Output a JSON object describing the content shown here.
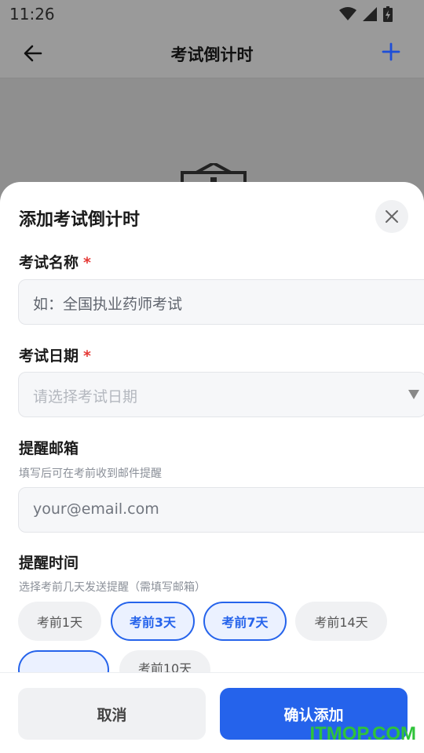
{
  "status_bar": {
    "time": "11:26"
  },
  "header": {
    "title": "考试倒计时"
  },
  "sheet": {
    "title": "添加考试倒计时",
    "exam_name": {
      "label": "考试名称",
      "required_mark": "*",
      "placeholder": "如：全国执业药师考试"
    },
    "exam_date": {
      "label": "考试日期",
      "required_mark": "*",
      "placeholder": "请选择考试日期"
    },
    "email": {
      "label": "提醒邮箱",
      "hint": "填写后可在考前收到邮件提醒",
      "placeholder": "your@email.com"
    },
    "remind": {
      "label": "提醒时间",
      "hint": "选择考前几天发送提醒（需填写邮箱）",
      "options": [
        {
          "label": "考前1天",
          "selected": false
        },
        {
          "label": "考前3天",
          "selected": true
        },
        {
          "label": "考前7天",
          "selected": true
        },
        {
          "label": "考前14天",
          "selected": false
        },
        {
          "label": "",
          "selected": true
        },
        {
          "label": "考前10天",
          "selected": false
        }
      ]
    },
    "buttons": {
      "cancel": "取消",
      "confirm": "确认添加"
    }
  },
  "watermark": "ITMOP.COM",
  "colors": {
    "accent": "#2563eb",
    "required": "#e53935",
    "watermark": "#2fc33a"
  }
}
